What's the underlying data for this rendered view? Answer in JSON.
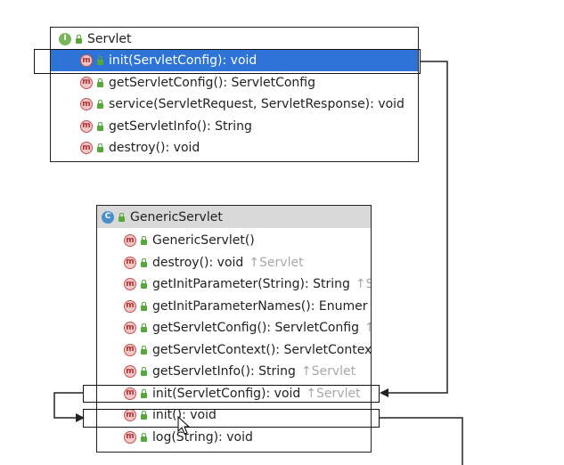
{
  "servlet": {
    "title": "Servlet",
    "icon": "interface-icon",
    "badge": "I",
    "methods": [
      {
        "label": "init(ServletConfig): void",
        "selected": true
      },
      {
        "label": "getServletConfig(): ServletConfig"
      },
      {
        "label": "service(ServletRequest, ServletResponse): void"
      },
      {
        "label": "getServletInfo(): String"
      },
      {
        "label": "destroy(): void"
      }
    ]
  },
  "generic": {
    "title": "GenericServlet",
    "icon": "class-icon",
    "badge": "C",
    "methods": [
      {
        "label": "GenericServlet()",
        "inherit": ""
      },
      {
        "label": "destroy(): void",
        "inherit": "↑Servlet"
      },
      {
        "label": "getInitParameter(String): String",
        "inherit": "↑S"
      },
      {
        "label": "getInitParameterNames(): Enumer",
        "inherit": ""
      },
      {
        "label": "getServletConfig(): ServletConfig",
        "inherit": "↑"
      },
      {
        "label": "getServletContext(): ServletContex",
        "inherit": ""
      },
      {
        "label": "getServletInfo(): String",
        "inherit": "↑Servlet"
      },
      {
        "label": "init(ServletConfig): void",
        "inherit": "↑Servlet"
      },
      {
        "label": "init(): void",
        "inherit": ""
      },
      {
        "label": "log(String): void",
        "inherit": ""
      }
    ]
  },
  "method_badge": "m",
  "colors": {
    "selection": "#2d74d6",
    "line": "#222222"
  }
}
